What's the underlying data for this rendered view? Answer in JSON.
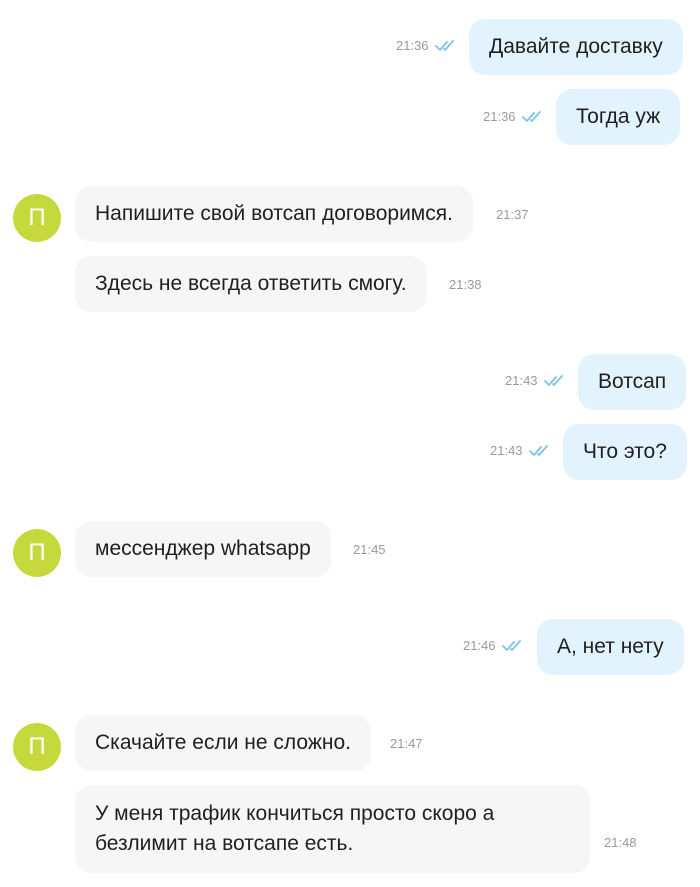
{
  "colors": {
    "outgoing_bubble": "#e3f3fd",
    "incoming_bubble": "#f6f6f6",
    "avatar": "#c5d93d",
    "read_checks": "#7cc4e8",
    "timestamp": "#9a9a9a"
  },
  "contact": {
    "avatar_letter": "П"
  },
  "messages": [
    {
      "direction": "out",
      "text": "Давайте доставку",
      "time": "21:36",
      "status": "read"
    },
    {
      "direction": "out",
      "text": "Тогда уж",
      "time": "21:36",
      "status": "read"
    },
    {
      "direction": "in",
      "text": "Напишите свой вотсап договоримся.",
      "time": "21:37"
    },
    {
      "direction": "in",
      "text": "Здесь не всегда ответить смогу.",
      "time": "21:38"
    },
    {
      "direction": "out",
      "text": "Вотсап",
      "time": "21:43",
      "status": "read"
    },
    {
      "direction": "out",
      "text": "Что это?",
      "time": "21:43",
      "status": "read"
    },
    {
      "direction": "in",
      "text": "мессенджер whatsapp",
      "time": "21:45"
    },
    {
      "direction": "out",
      "text": "А, нет нету",
      "time": "21:46",
      "status": "read"
    },
    {
      "direction": "in",
      "text": "Скачайте если не сложно.",
      "time": "21:47"
    },
    {
      "direction": "in",
      "text": "У меня трафик кончиться просто скоро а безлимит на вотсапе есть.",
      "time": "21:48"
    }
  ]
}
